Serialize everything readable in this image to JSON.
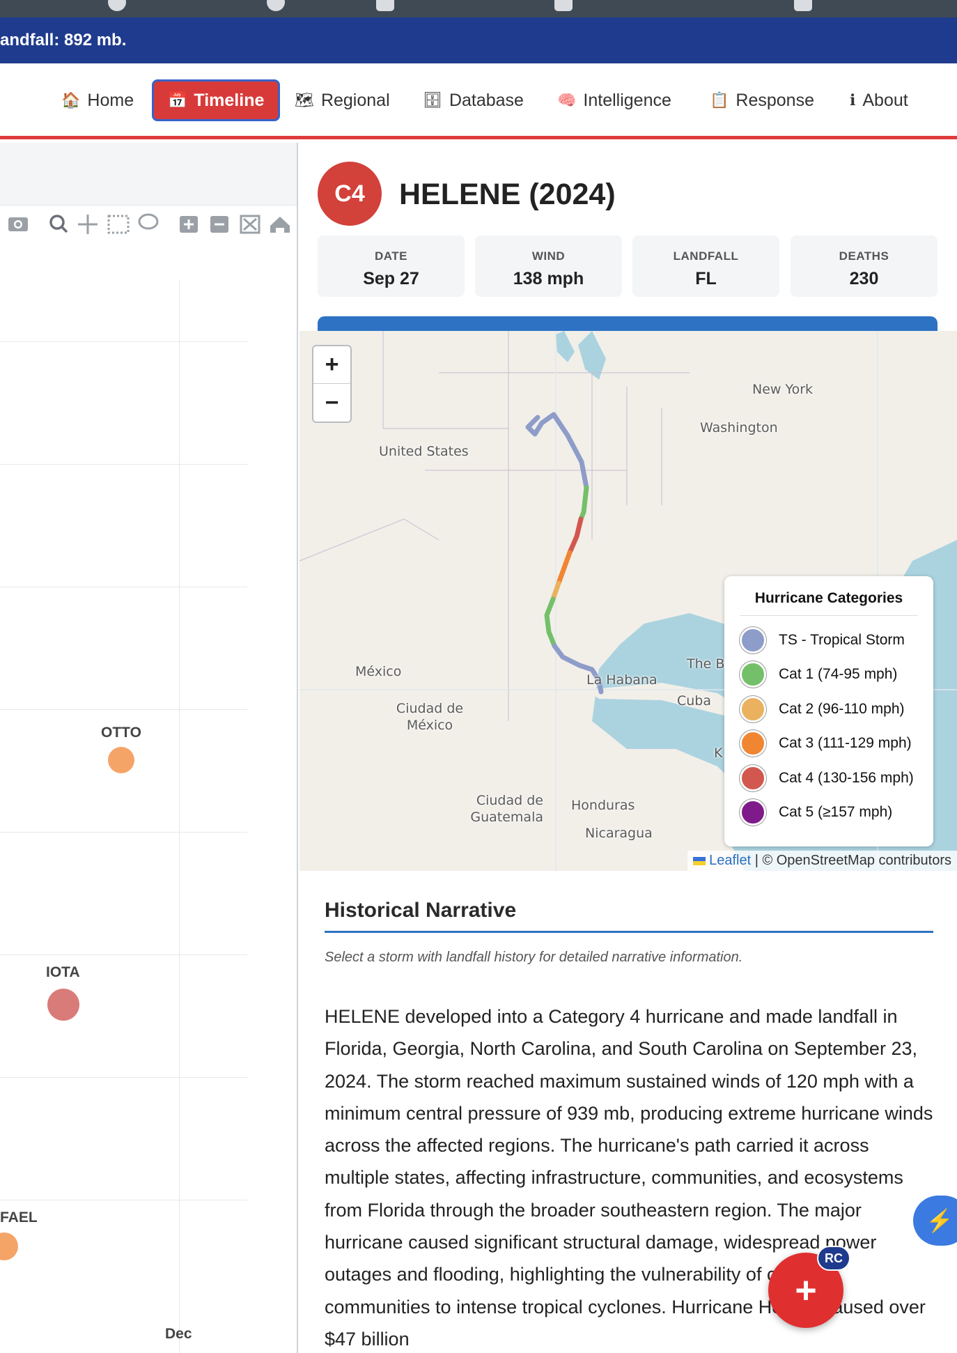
{
  "banner": {
    "text": "andfall: 892 mb."
  },
  "nav": [
    {
      "icon": "🏠",
      "icon_name": "home-icon",
      "label": "Home"
    },
    {
      "icon": "📅",
      "icon_name": "calendar-icon",
      "label": "Timeline",
      "active": true
    },
    {
      "icon": "🗺",
      "icon_name": "map-icon",
      "label": "Regional"
    },
    {
      "icon": "🗄",
      "icon_name": "database-icon",
      "label": "Database"
    },
    {
      "icon": "🧠",
      "icon_name": "brain-icon",
      "label": "Intelligence"
    },
    {
      "icon": "📋",
      "icon_name": "clipboard-icon",
      "label": "Response"
    },
    {
      "icon": "ℹ",
      "icon_name": "info-icon",
      "label": "About"
    }
  ],
  "chart": {
    "modebar": [
      "camera-icon",
      "zoom-icon",
      "pan-icon",
      "box-select-icon",
      "lasso-icon",
      "zoom-in-icon",
      "zoom-out-icon",
      "autoscale-icon",
      "reset-home-icon"
    ],
    "storms": [
      {
        "name": "OTTO",
        "color": "#f5a467"
      },
      {
        "name": "IOTA",
        "color": "#d97b78"
      },
      {
        "name": "FAEL",
        "color": "#f5a467"
      }
    ],
    "x_label": "Dec"
  },
  "storm": {
    "badge": "C4",
    "title": "HELENE (2024)",
    "stats": [
      {
        "label": "DATE",
        "value": "Sep 27"
      },
      {
        "label": "WIND",
        "value": "138 mph"
      },
      {
        "label": "LANDFALL",
        "value": "FL"
      },
      {
        "label": "DEATHS",
        "value": "230"
      }
    ]
  },
  "map": {
    "zoom_in": "+",
    "zoom_out": "−",
    "labels": {
      "new_york": "New York",
      "washington": "Washington",
      "united_states": "United States",
      "mexico": "México",
      "ciudad_de_mexico": "Ciudad de México",
      "la_habana": "La Habana",
      "cuba": "Cuba",
      "the_b": "The B",
      "ciudad_de_guatemala": "Ciudad de Guatemala",
      "honduras": "Honduras",
      "nicaragua": "Nicaragua",
      "k": "K"
    },
    "legend": {
      "title": "Hurricane Categories",
      "items": [
        {
          "label": "TS - Tropical Storm",
          "color": "#8e9cc9"
        },
        {
          "label": "Cat 1 (74-95 mph)",
          "color": "#74c06a"
        },
        {
          "label": "Cat 2 (96-110 mph)",
          "color": "#eab15e"
        },
        {
          "label": "Cat 3 (111-129 mph)",
          "color": "#f08532"
        },
        {
          "label": "Cat 4 (130-156 mph)",
          "color": "#d2574f"
        },
        {
          "label": "Cat 5 (≥157 mph)",
          "color": "#7e1a8a"
        }
      ]
    },
    "attribution": {
      "leaflet": "Leaflet",
      "osm": "| © OpenStreetMap contributors"
    }
  },
  "narrative": {
    "title": "Historical Narrative",
    "subtitle": "Select a storm with landfall history for detailed narrative information.",
    "body": "HELENE developed into a Category 4 hurricane and made landfall in Florida, Georgia, North Carolina, and South Carolina on September 23, 2024. The storm reached maximum sustained winds of 120 mph with a minimum central pressure of 939 mb, producing extreme hurricane winds across the affected regions. The hurricane's path carried it across multiple states, affecting infrastructure, communities, and ecosystems from Florida through the broader southeastern region. The major hurricane caused significant structural damage, widespread power outages and flooding, highlighting the vulnerability of coastal communities to intense tropical cyclones. Hurricane Helene caused over $47 billion"
  },
  "fab": {
    "label": "+",
    "badge": "RC"
  },
  "bolt": {
    "label": "⚡"
  }
}
